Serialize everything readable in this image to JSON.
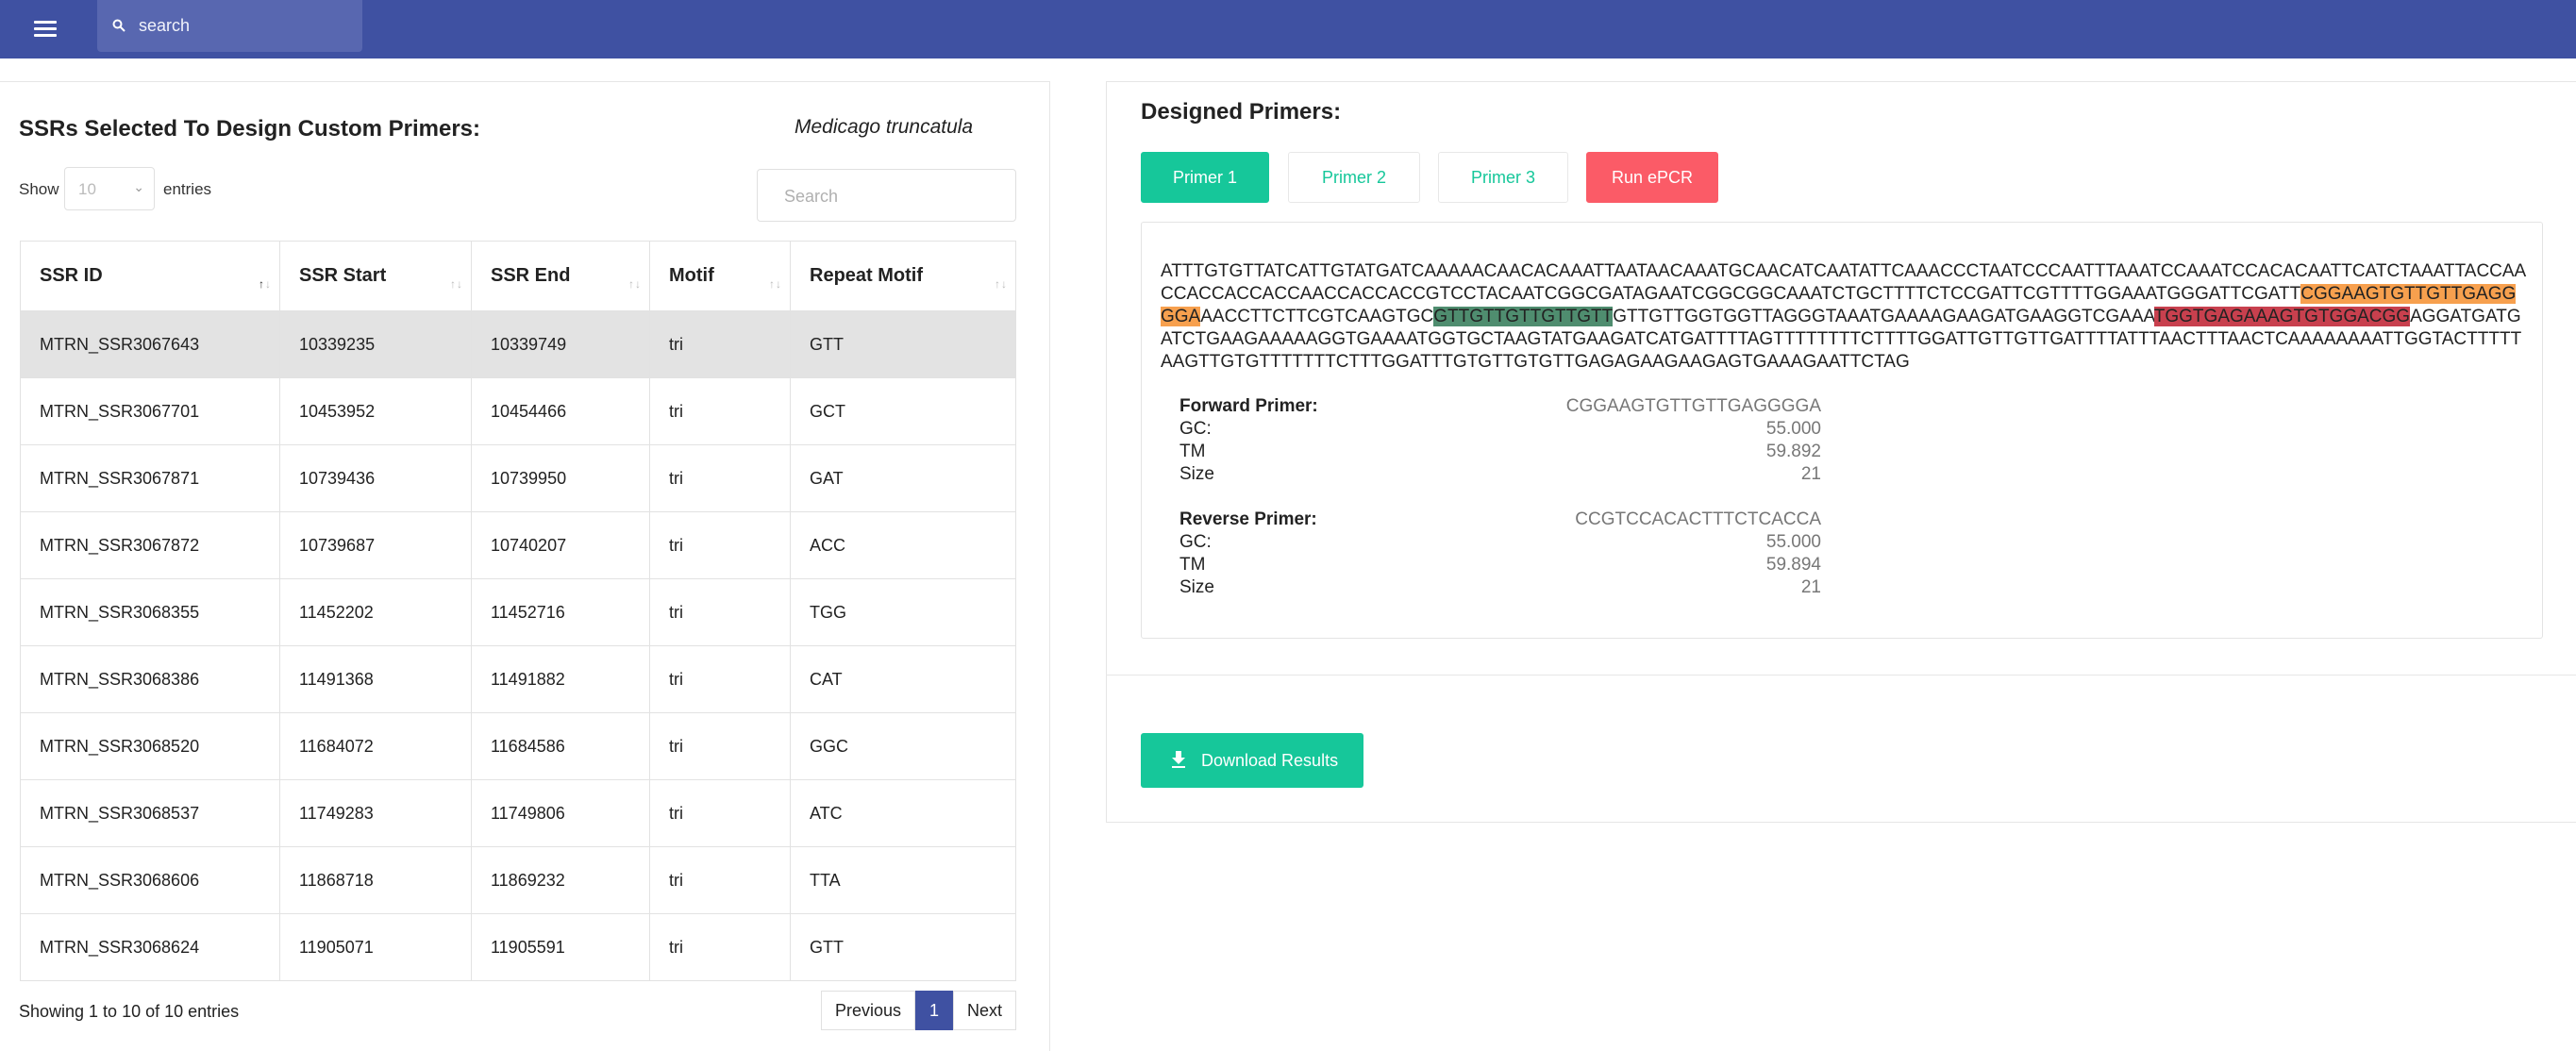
{
  "header": {
    "search_placeholder": "search"
  },
  "left": {
    "title": "SSRs Selected To Design Custom Primers:",
    "species": "Medicago truncatula",
    "show_label": "Show",
    "page_size": "10",
    "entries_label": "entries",
    "search_placeholder": "Search",
    "columns": [
      "SSR ID",
      "SSR Start",
      "SSR End",
      "Motif",
      "Repeat Motif"
    ],
    "rows": [
      [
        "MTRN_SSR3067643",
        "10339235",
        "10339749",
        "tri",
        "GTT"
      ],
      [
        "MTRN_SSR3067701",
        "10453952",
        "10454466",
        "tri",
        "GCT"
      ],
      [
        "MTRN_SSR3067871",
        "10739436",
        "10739950",
        "tri",
        "GAT"
      ],
      [
        "MTRN_SSR3067872",
        "10739687",
        "10740207",
        "tri",
        "ACC"
      ],
      [
        "MTRN_SSR3068355",
        "11452202",
        "11452716",
        "tri",
        "TGG"
      ],
      [
        "MTRN_SSR3068386",
        "11491368",
        "11491882",
        "tri",
        "CAT"
      ],
      [
        "MTRN_SSR3068520",
        "11684072",
        "11684586",
        "tri",
        "GGC"
      ],
      [
        "MTRN_SSR3068537",
        "11749283",
        "11749806",
        "tri",
        "ATC"
      ],
      [
        "MTRN_SSR3068606",
        "11868718",
        "11869232",
        "tri",
        "TTA"
      ],
      [
        "MTRN_SSR3068624",
        "11905071",
        "11905591",
        "tri",
        "GTT"
      ]
    ],
    "showing_text": "Showing 1 to 10 of 10 entries",
    "pager": {
      "previous": "Previous",
      "current": "1",
      "next": "Next"
    }
  },
  "right": {
    "title": "Designed Primers:",
    "buttons": {
      "primer1": "Primer 1",
      "primer2": "Primer 2",
      "primer3": "Primer 3",
      "run_epcr": "Run ePCR"
    },
    "sequence": {
      "part1": "ATTTGTGTTATCATTGTATGATCAAAAACAACACAAATTAATAACAAATGCAACATCAATATTCAAACCCTAATCCCAATTTAAATCCAAATCCACACAATTCATCTAAATTACCAACCACCACCACCAACCACCACCGTCCTACAATCGGCGATAGAATCGGCGGCAAATCTGCTTTTCTCCGATTCGTTTTGGAAATGGGATTCGATT",
      "forward": "CGGAAGTGTTGTTGAGGGGA",
      "part2": "AACCTTCTTCGTCAAGTGC",
      "ssr": "GTTGTTGTTGTTGTT",
      "part3": "GTTGTTGGTGGTTAGGGTAAATGAAAAGAAGATGAAGGTCGAAA",
      "reverse": "TGGTGAGAAAGTGTGGACGG",
      "part4": "AGGATGATGATCTGAAGAAAAAGGTGAAAATGGTGCTAAGTATGAAGATCATGATTTTAGTTTTTTTTCTTTTGGATTGTTGTTGATTTTATTTAACTTTAACTCAAAAAAAATTGGTACTTTTTAAGTTGTGTTTTTTTCTTTGGATTTGTGTTGTGTTGAGAGAAGAAGAGTGAAAGAATTCTAG"
    },
    "forward_primer": {
      "label": "Forward Primer:",
      "seq": "CGGAAGTGTTGTTGAGGGGA",
      "gc_label": "GC:",
      "gc": "55.000",
      "tm_label": "TM",
      "tm": "59.892",
      "size_label": "Size",
      "size": "21"
    },
    "reverse_primer": {
      "label": "Reverse Primer:",
      "seq": "CCGTCCACACTTTCTCACCA",
      "gc_label": "GC:",
      "gc": "55.000",
      "tm_label": "TM",
      "tm": "59.894",
      "size_label": "Size",
      "size": "21"
    },
    "download_label": "Download Results"
  },
  "colors": {
    "header": "#3f51a2",
    "primary_green": "#16c79a",
    "epcr_red": "#fb5b67",
    "forward_highlight": "#f7a04e",
    "ssr_highlight": "#4f8d6f",
    "reverse_highlight": "#c8404e"
  }
}
